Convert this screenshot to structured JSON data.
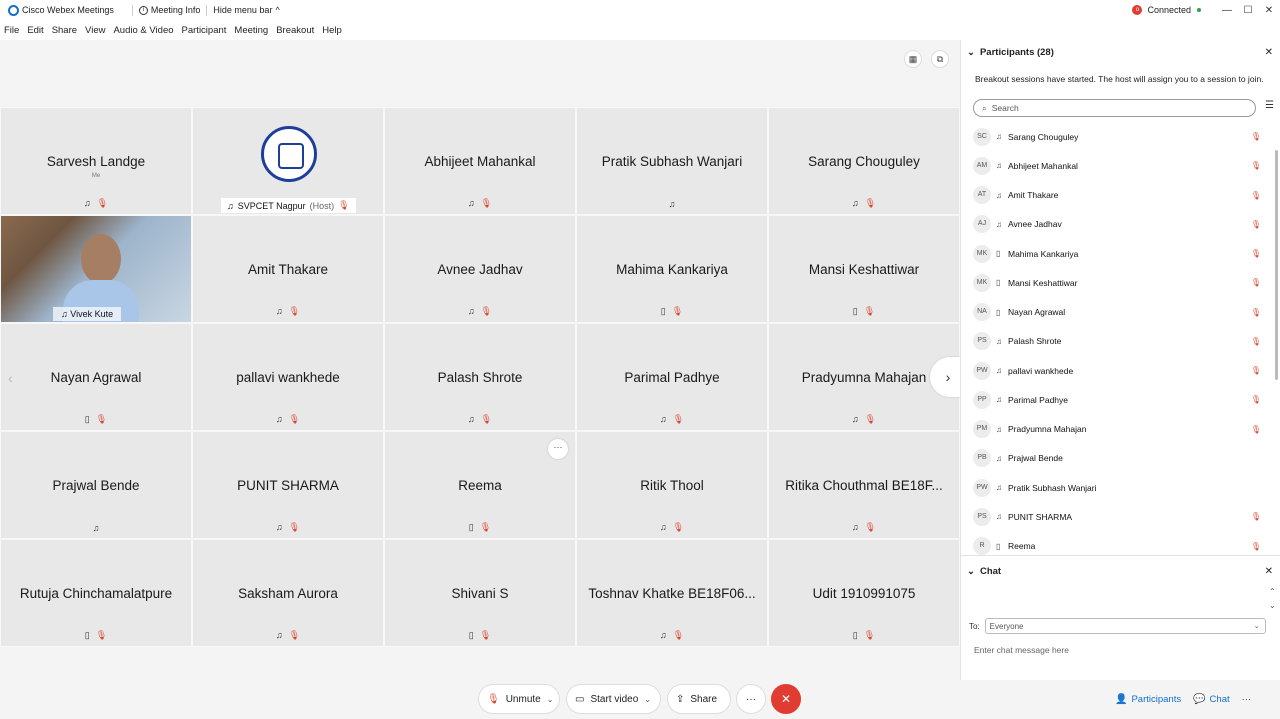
{
  "titlebar": {
    "app": "Cisco Webex Meetings",
    "meeting_info": "Meeting Info",
    "hide_menu": "Hide menu bar",
    "connected": "Connected"
  },
  "menu": [
    "File",
    "Edit",
    "Share",
    "View",
    "Audio & Video",
    "Participant",
    "Meeting",
    "Breakout",
    "Help"
  ],
  "tiles": [
    {
      "name": "Sarvesh Landge",
      "sub": "Me",
      "icons": "mic-muted"
    },
    {
      "name": "SVPCET Nagpur",
      "host": "(Host)",
      "type": "host"
    },
    {
      "name": "Abhijeet Mahankal",
      "icons": "mic-muted"
    },
    {
      "name": "Pratik Subhash Wanjari",
      "icons": "audio"
    },
    {
      "name": "Sarang Chouguley",
      "icons": "mic-muted"
    },
    {
      "name": "Vivek Kute",
      "type": "video"
    },
    {
      "name": "Amit Thakare",
      "icons": "mic-muted"
    },
    {
      "name": "Avnee Jadhav",
      "icons": "mic-muted"
    },
    {
      "name": "Mahima Kankariya",
      "icons": "phone-muted"
    },
    {
      "name": "Mansi Keshattiwar",
      "icons": "phone-muted"
    },
    {
      "name": "Nayan Agrawal",
      "icons": "phone-muted"
    },
    {
      "name": "pallavi wankhede",
      "icons": "mic-muted"
    },
    {
      "name": "Palash Shrote",
      "icons": "mic-muted"
    },
    {
      "name": "Parimal Padhye",
      "icons": "mic-muted"
    },
    {
      "name": "Pradyumna Mahajan",
      "icons": "mic-muted"
    },
    {
      "name": "Prajwal Bende",
      "icons": "audio"
    },
    {
      "name": "PUNIT SHARMA",
      "icons": "mic-muted"
    },
    {
      "name": "Reema",
      "icons": "phone-muted"
    },
    {
      "name": "Ritik Thool",
      "icons": "mic-muted"
    },
    {
      "name": "Ritika Chouthmal BE18F...",
      "icons": "mic-muted"
    },
    {
      "name": "Rutuja Chinchamalatpure",
      "icons": "phone-muted"
    },
    {
      "name": "Saksham Aurora",
      "icons": "mic-muted"
    },
    {
      "name": "Shivani S",
      "icons": "phone-muted"
    },
    {
      "name": "Toshnav Khatke BE18F06...",
      "icons": "mic-muted"
    },
    {
      "name": "Udit 1910991075",
      "icons": "phone-muted"
    }
  ],
  "controls": {
    "unmute": "Unmute",
    "start_video": "Start video",
    "share": "Share",
    "more": "···",
    "end": "✕"
  },
  "participants": {
    "header": "Participants (28)",
    "breakout_msg": "Breakout sessions have started. The host will assign you to a session to join.",
    "search_placeholder": "Search",
    "list": [
      {
        "initials": "SC",
        "name": "Sarang Chouguley",
        "device": "audio",
        "muted": true
      },
      {
        "initials": "AM",
        "name": "Abhijeet Mahankal",
        "device": "audio",
        "muted": true
      },
      {
        "initials": "AT",
        "name": "Amit Thakare",
        "device": "audio",
        "muted": true
      },
      {
        "initials": "AJ",
        "name": "Avnee Jadhav",
        "device": "audio",
        "muted": true
      },
      {
        "initials": "MK",
        "name": "Mahima Kankariya",
        "device": "phone",
        "muted": true
      },
      {
        "initials": "MK",
        "name": "Mansi Keshattiwar",
        "device": "phone",
        "muted": true
      },
      {
        "initials": "NA",
        "name": "Nayan Agrawal",
        "device": "phone",
        "muted": true
      },
      {
        "initials": "PS",
        "name": "Palash Shrote",
        "device": "audio",
        "muted": true
      },
      {
        "initials": "PW",
        "name": "pallavi wankhede",
        "device": "audio",
        "muted": true
      },
      {
        "initials": "PP",
        "name": "Parimal Padhye",
        "device": "audio",
        "muted": true
      },
      {
        "initials": "PM",
        "name": "Pradyumna Mahajan",
        "device": "audio",
        "muted": true
      },
      {
        "initials": "PB",
        "name": "Prajwal Bende",
        "device": "audio",
        "muted": false
      },
      {
        "initials": "PW",
        "name": "Pratik Subhash Wanjari",
        "device": "audio",
        "muted": false
      },
      {
        "initials": "PS",
        "name": "PUNIT SHARMA",
        "device": "audio",
        "muted": true
      },
      {
        "initials": "R",
        "name": "Reema",
        "device": "phone",
        "muted": true
      }
    ]
  },
  "chat": {
    "header": "Chat",
    "to_label": "To:",
    "to_value": "Everyone",
    "placeholder": "Enter chat message here"
  },
  "panel_tabs": {
    "participants": "Participants",
    "chat": "Chat",
    "more": "···"
  }
}
